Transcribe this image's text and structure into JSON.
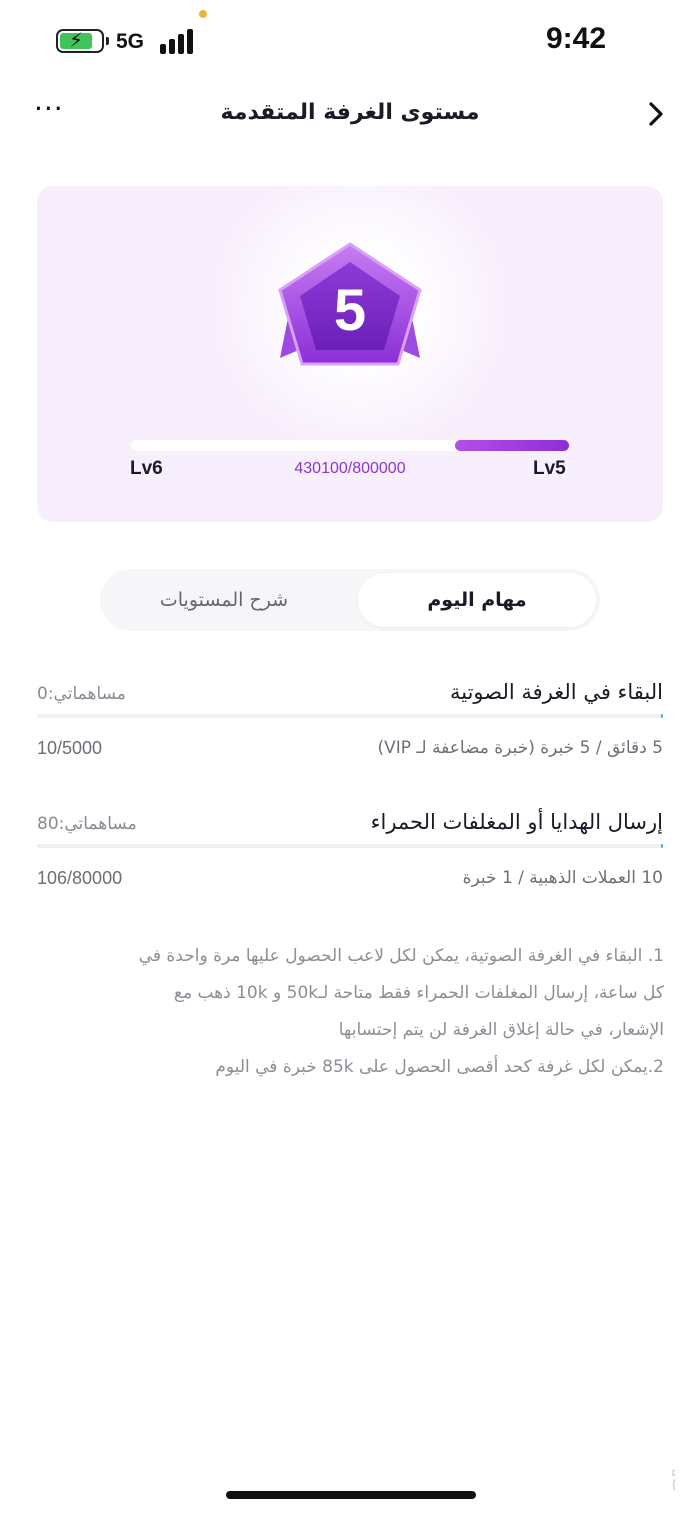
{
  "status_bar": {
    "time": "9:42",
    "network": "5G",
    "battery_level": 0.8,
    "icons": [
      "battery-charging-icon",
      "signal-icon"
    ]
  },
  "header": {
    "title": "مستوى الغرفة المتقدمة",
    "more_label": "···",
    "back_icon": "chevron-right-icon"
  },
  "level_card": {
    "badge_number": "5",
    "current_level": "Lv5",
    "next_level": "Lv6",
    "progress_text": "430100/800000",
    "progress_fraction": 0.26,
    "colors": {
      "accent": "#9b3fe0",
      "card_bg": "#f8effd"
    }
  },
  "tabs": [
    {
      "label": "مهام اليوم",
      "active": true
    },
    {
      "label": "شرح المستويات",
      "active": false
    }
  ],
  "tasks": [
    {
      "title": "البقاء في الغرفة الصوتية",
      "contribution": "مساهماتي:0",
      "description": "5 دقائق / 5 خبرة (خبرة مضاعفة لـ VIP)",
      "count": "10/5000",
      "progress_fraction": 0.002
    },
    {
      "title": "إرسال الهدايا أو المغلفات الحمراء",
      "contribution": "مساهماتي:80",
      "description": "10 العملات الذهبية / 1 خبرة",
      "count": "106/80000",
      "progress_fraction": 0.0013
    }
  ],
  "notes": {
    "line1": "1. البقاء في الغرفة الصوتية، يمكن لكل لاعب الحصول عليها مرة واحدة في",
    "line2": "كل ساعة، إرسال المغلفات الحمراء فقط متاحة لـ50k و 10k ذهب مع",
    "line3": "الإشعار، في حالة إغلاق الغرفة لن يتم إحتسابها",
    "line4": "2.يمكن لكل غرفة كحد أقصى الحصول على 85k خبرة في اليوم"
  },
  "watermark": {
    "text": "حراج"
  }
}
